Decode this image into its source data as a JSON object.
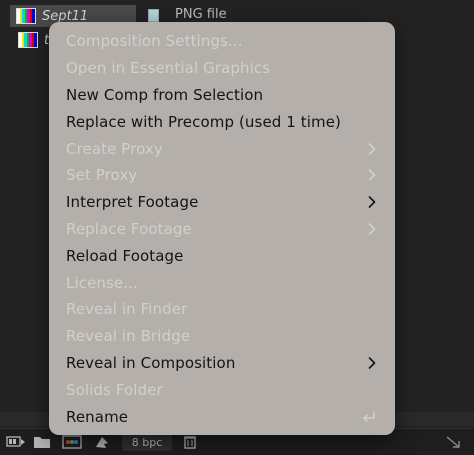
{
  "project_items": [
    {
      "name": "Sept11",
      "type": "PNG file"
    },
    {
      "name": "t",
      "type": ""
    }
  ],
  "bottom_bar": {
    "bit_depth": "8 bpc"
  },
  "context_menu": {
    "items": [
      {
        "label": "Composition Settings...",
        "enabled": false,
        "submenu": false
      },
      {
        "label": "Open in Essential Graphics",
        "enabled": false,
        "submenu": false
      },
      {
        "label": "New Comp from Selection",
        "enabled": true,
        "submenu": false
      },
      {
        "label": "Replace with Precomp (used 1 time)",
        "enabled": true,
        "submenu": false
      },
      {
        "label": "Create Proxy",
        "enabled": false,
        "submenu": true
      },
      {
        "label": "Set Proxy",
        "enabled": false,
        "submenu": true
      },
      {
        "label": "Interpret Footage",
        "enabled": true,
        "submenu": true
      },
      {
        "label": "Replace Footage",
        "enabled": false,
        "submenu": true
      },
      {
        "label": "Reload Footage",
        "enabled": true,
        "submenu": false
      },
      {
        "label": "License...",
        "enabled": false,
        "submenu": false
      },
      {
        "label": "Reveal in Finder",
        "enabled": false,
        "submenu": false
      },
      {
        "label": "Reveal in Bridge",
        "enabled": false,
        "submenu": false
      },
      {
        "label": "Reveal in Composition",
        "enabled": true,
        "submenu": true
      },
      {
        "label": "Solids Folder",
        "enabled": false,
        "submenu": false
      },
      {
        "label": "Rename",
        "enabled": true,
        "submenu": false,
        "shortcut_icon": "return-key-icon"
      }
    ]
  },
  "colors": {
    "menu_bg": "#b5afab",
    "enabled_text": "#141414",
    "disabled_text": "#d3cfcb",
    "panel_bg": "#232323"
  }
}
